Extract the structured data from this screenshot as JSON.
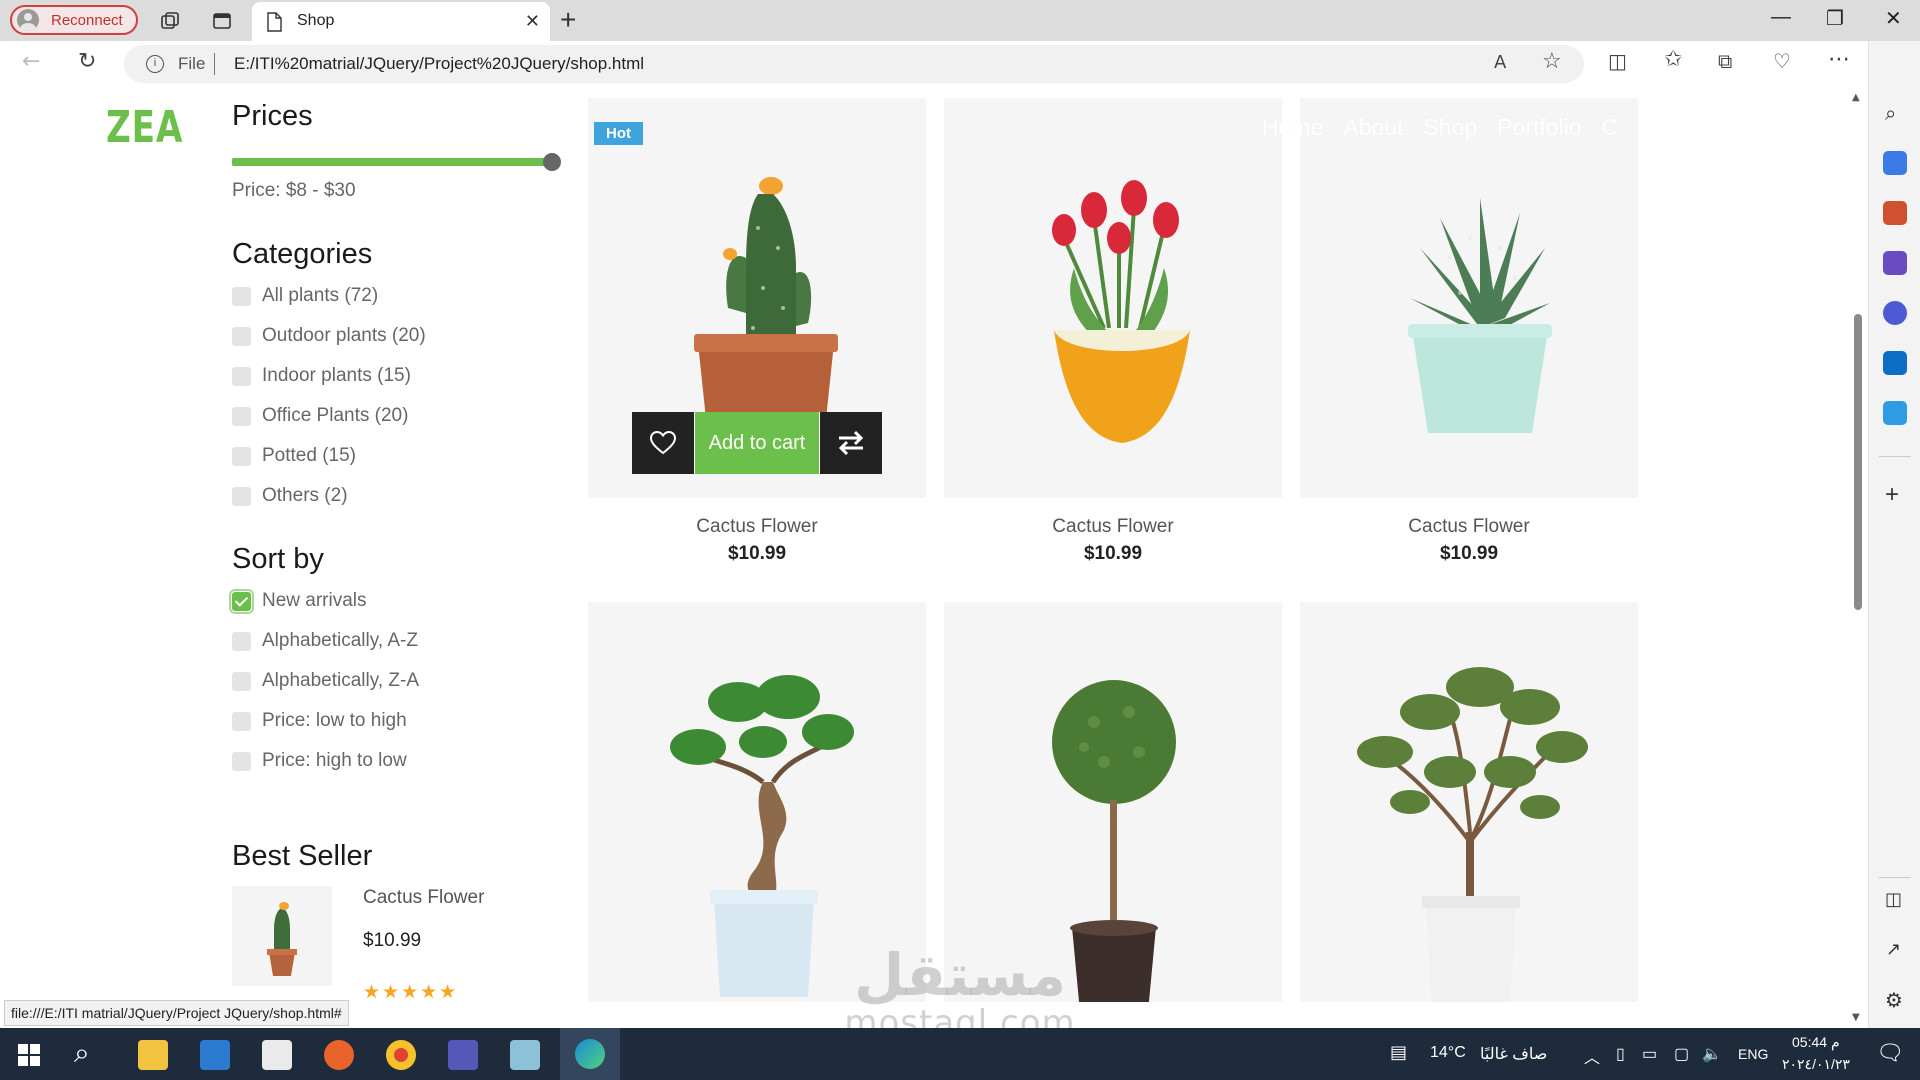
{
  "browser": {
    "reconnect_label": "Reconnect",
    "tab_title": "Shop",
    "tab_close": "✕",
    "new_tab": "+",
    "file_label": "File",
    "url": "E:/ITI%20matrial/JQuery/Project%20JQuery/shop.html",
    "status_url": "file:///E:/ITI matrial/JQuery/Project JQuery/shop.html#"
  },
  "brand": {
    "logo": "ZEA"
  },
  "nav": {
    "items": [
      "Home",
      "About",
      "Shop",
      "Portfolio",
      "C"
    ]
  },
  "sidebar": {
    "prices_title": "Prices",
    "price_range_text": "Price: $8 - $30",
    "price_slider_fraction": 1.0,
    "categories_title": "Categories",
    "categories": [
      {
        "label": "All plants (72)",
        "checked": false
      },
      {
        "label": "Outdoor plants (20)",
        "checked": false
      },
      {
        "label": "Indoor plants (15)",
        "checked": false
      },
      {
        "label": "Office Plants (20)",
        "checked": false
      },
      {
        "label": "Potted (15)",
        "checked": false
      },
      {
        "label": "Others (2)",
        "checked": false
      }
    ],
    "sort_title": "Sort by",
    "sort_options": [
      {
        "label": "New arrivals",
        "checked": true
      },
      {
        "label": "Alphabetically, A-Z",
        "checked": false
      },
      {
        "label": "Alphabetically, Z-A",
        "checked": false
      },
      {
        "label": "Price: low to high",
        "checked": false
      },
      {
        "label": "Price: high to low",
        "checked": false
      }
    ],
    "best_seller_title": "Best Seller",
    "best_seller": {
      "name": "Cactus Flower",
      "price": "$10.99",
      "stars": "★★★★★"
    }
  },
  "products": [
    {
      "name": "Cactus Flower",
      "price": "$10.99",
      "badge": "Hot",
      "plant": "cactus"
    },
    {
      "name": "Cactus Flower",
      "price": "$10.99",
      "badge": "",
      "plant": "tulip"
    },
    {
      "name": "Cactus Flower",
      "price": "$10.99",
      "badge": "",
      "plant": "succulent"
    },
    {
      "name": "",
      "price": "",
      "badge": "",
      "plant": "bonsai"
    },
    {
      "name": "",
      "price": "",
      "badge": "",
      "plant": "topiary"
    },
    {
      "name": "",
      "price": "",
      "badge": "",
      "plant": "olive"
    }
  ],
  "card_actions": {
    "add_to_cart": "Add to cart"
  },
  "watermark": {
    "arabic": "مستقل",
    "latin": "mostaql.com"
  },
  "taskbar": {
    "temperature": "14°C",
    "weather_text": "صاف غالبًا",
    "language": "ENG",
    "time": "05:44 م",
    "date": "٢٠٢٤/٠١/٢٣"
  },
  "colors": {
    "accent": "#6dbf4b",
    "badge": "#3fa3de",
    "dark": "#222222"
  }
}
